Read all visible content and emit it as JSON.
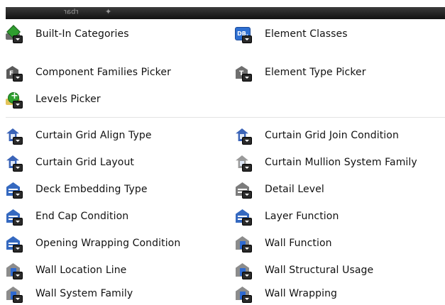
{
  "titlebar": {
    "text1": "ɹɐqɹ",
    "text2": "✦"
  },
  "sections": [
    {
      "items": [
        {
          "label": "Built-In Categories",
          "icon": "built-in-categories-icon"
        },
        {
          "label": "Element Classes",
          "icon": "element-classes-icon"
        },
        {
          "label": "Component Families Picker",
          "icon": "component-families-icon"
        },
        {
          "label": "Element Type Picker",
          "icon": "element-type-icon"
        },
        {
          "label": "Levels Picker",
          "icon": "levels-picker-icon"
        }
      ]
    },
    {
      "items": [
        {
          "label": "Curtain Grid Align Type",
          "icon": "curtain-grid-icon"
        },
        {
          "label": "Curtain Grid Join Condition",
          "icon": "curtain-grid-icon"
        },
        {
          "label": "Curtain Grid Layout",
          "icon": "curtain-grid-icon"
        },
        {
          "label": "Curtain Mullion System Family",
          "icon": "curtain-mullion-icon"
        },
        {
          "label": "Deck Embedding Type",
          "icon": "deck-icon"
        },
        {
          "label": "Detail Level",
          "icon": "detail-level-icon"
        },
        {
          "label": "End Cap Condition",
          "icon": "deck-icon"
        },
        {
          "label": "Layer Function",
          "icon": "deck-icon"
        },
        {
          "label": "Opening Wrapping Condition",
          "icon": "deck-icon"
        },
        {
          "label": "Wall Function",
          "icon": "wall-icon"
        },
        {
          "label": "Wall Location Line",
          "icon": "wall-icon"
        },
        {
          "label": "Wall Structural Usage",
          "icon": "wall-icon"
        },
        {
          "label": "Wall System Family",
          "icon": "wall-icon"
        },
        {
          "label": "Wall Wrapping",
          "icon": "wall-icon"
        }
      ]
    }
  ],
  "colors": {
    "titlebar": "#1a1a1a",
    "blue": "#3569c0",
    "green": "#2f9e2f"
  }
}
